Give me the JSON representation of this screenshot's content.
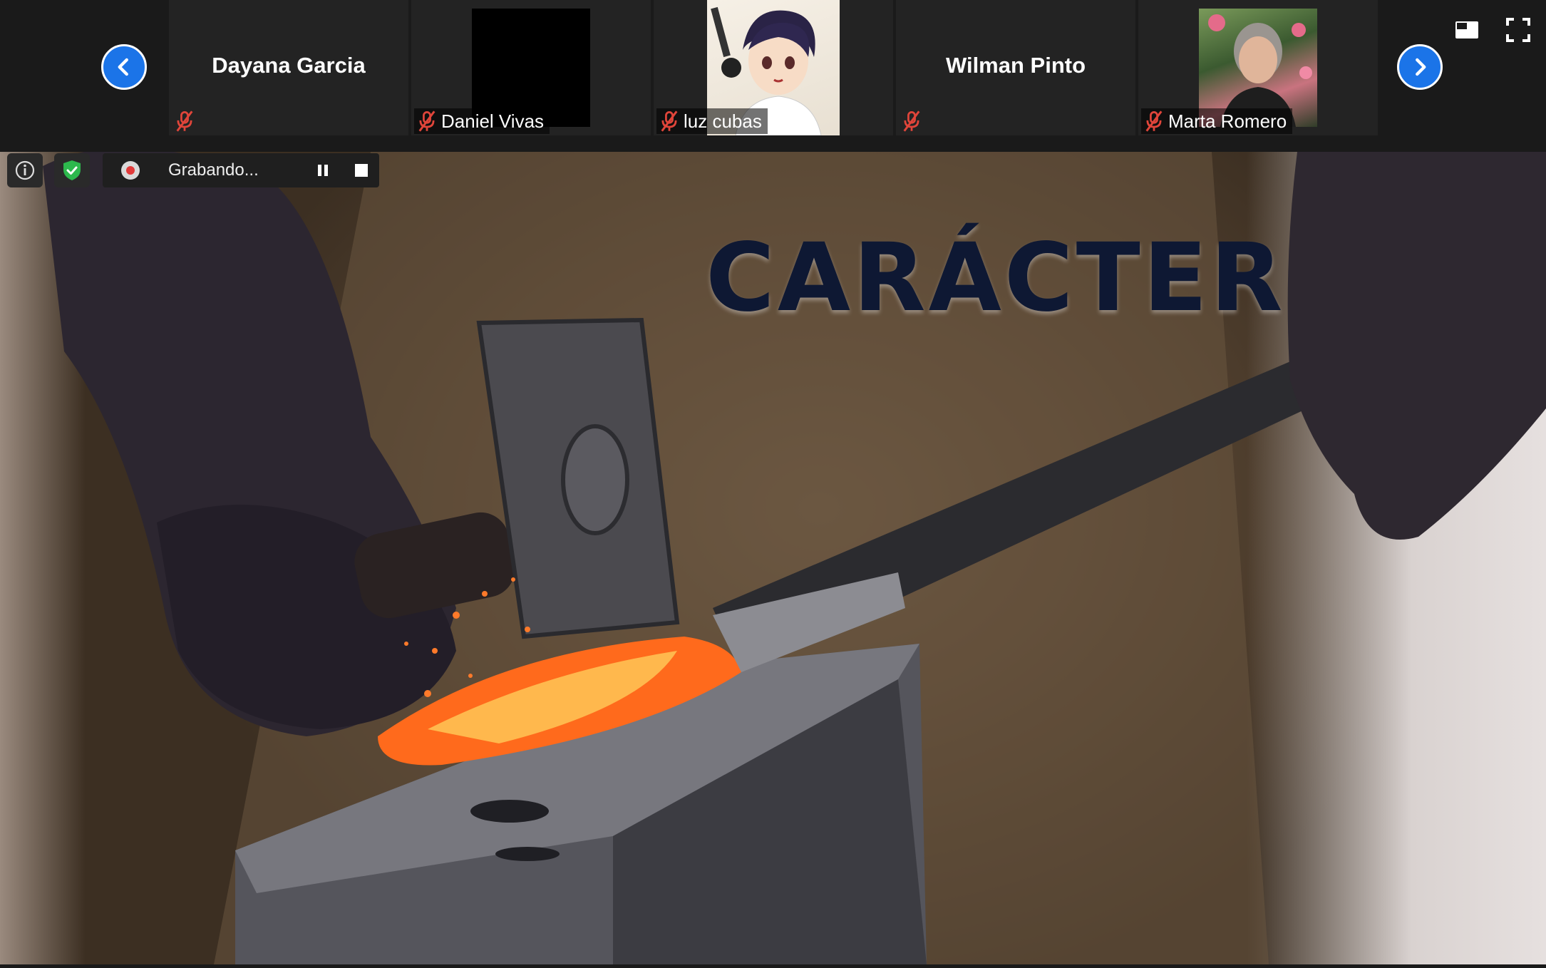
{
  "participants": [
    {
      "name": "Dayana Garcia",
      "label": ""
    },
    {
      "name": "",
      "label": "Daniel Vivas"
    },
    {
      "name": "",
      "label": "luz cubas"
    },
    {
      "name": "Wilman Pinto",
      "label": ""
    },
    {
      "name": "",
      "label": "Marta Romero"
    }
  ],
  "recording": {
    "status_text": "Grabando..."
  },
  "slide": {
    "title": "CARÁCTER"
  },
  "icons": {
    "prev": "chevron-left-icon",
    "next": "chevron-right-icon",
    "mic": "mic-muted-icon",
    "view": "view-layout-icon",
    "fullscreen": "fullscreen-icon",
    "info": "info-icon",
    "shield": "shield-check-icon",
    "record": "record-dot-icon",
    "pause": "pause-icon",
    "stop": "stop-icon"
  },
  "colors": {
    "nav_button": "#1b74e8",
    "mic_muted": "#e0453a",
    "shield": "#2db84d",
    "title": "#0e1833"
  }
}
